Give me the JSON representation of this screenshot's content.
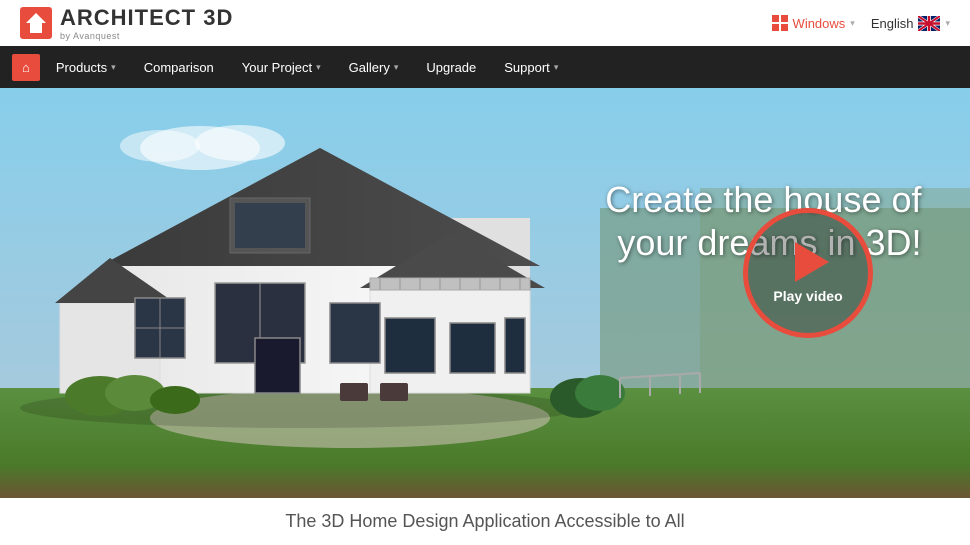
{
  "topbar": {
    "logo_main": "ARCHITECT 3D",
    "logo_by": "by Avanquest",
    "windows_label": "Windows",
    "lang_label": "English",
    "chevron": "▾"
  },
  "nav": {
    "home_icon": "🏠",
    "items": [
      {
        "label": "Products",
        "has_dropdown": true
      },
      {
        "label": "Comparison",
        "has_dropdown": false
      },
      {
        "label": "Your Project",
        "has_dropdown": true
      },
      {
        "label": "Gallery",
        "has_dropdown": true
      },
      {
        "label": "Upgrade",
        "has_dropdown": false
      },
      {
        "label": "Support",
        "has_dropdown": true
      }
    ]
  },
  "hero": {
    "title_line1": "Create the house of",
    "title_line2": "your dreams in 3D!",
    "play_label": "Play video"
  },
  "tagline": {
    "text": "The 3D Home Design Application Accessible to All"
  }
}
